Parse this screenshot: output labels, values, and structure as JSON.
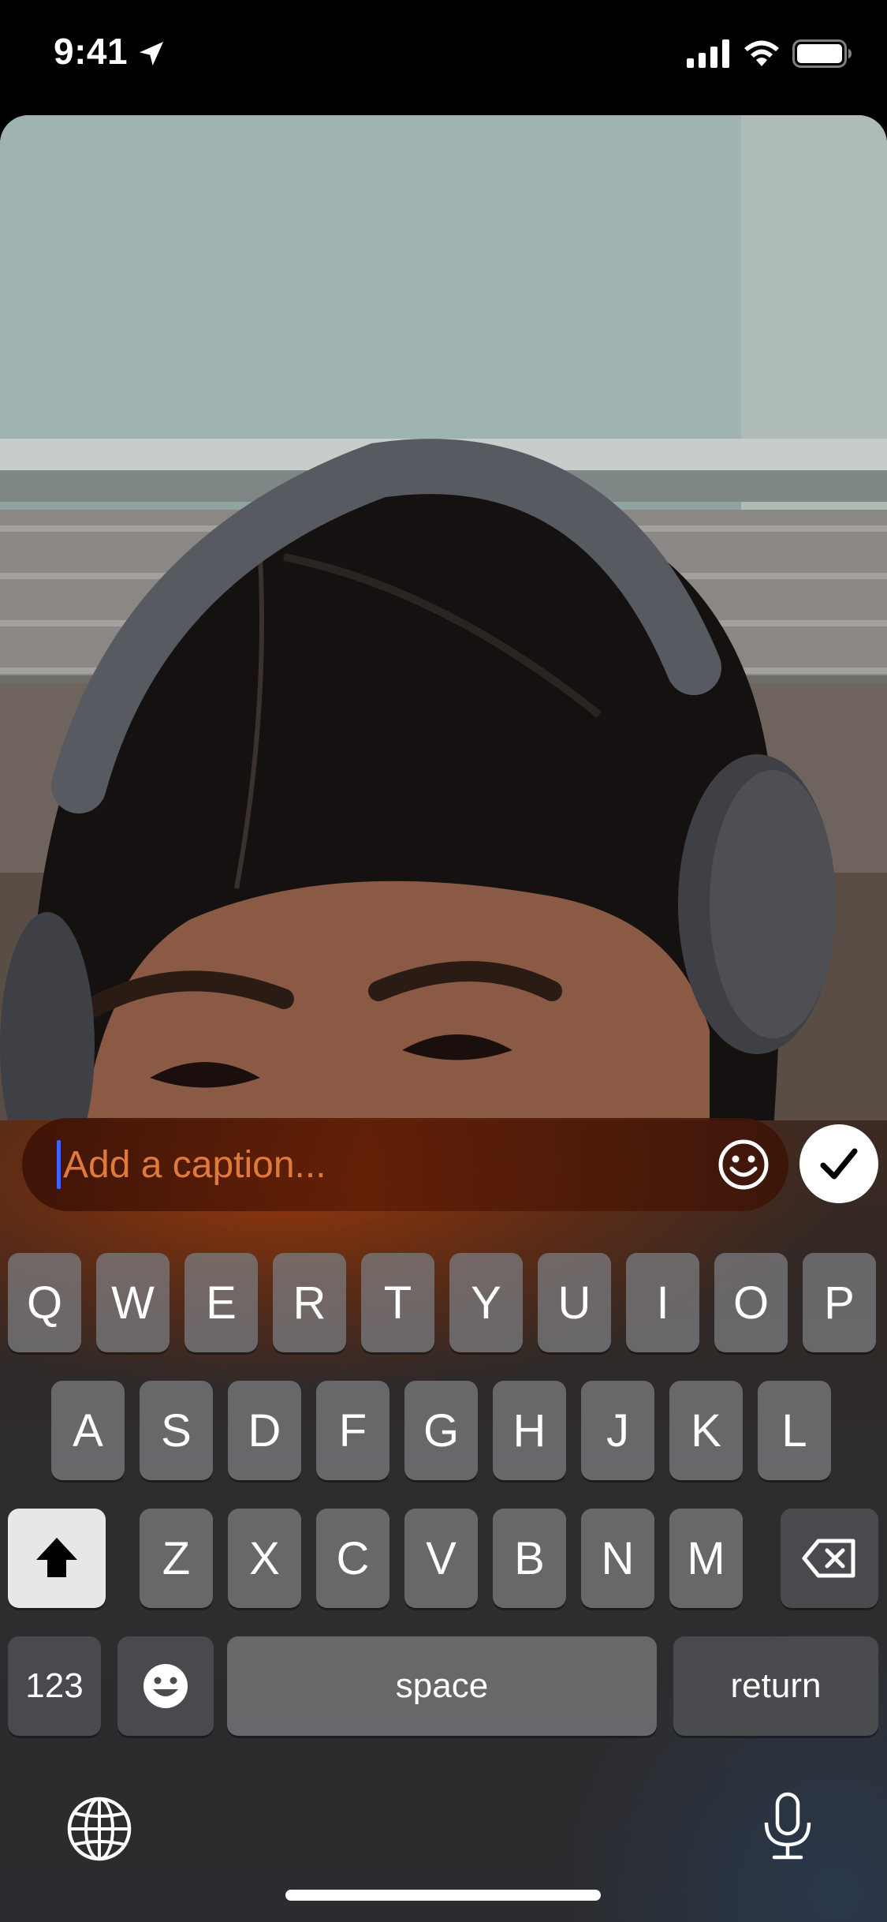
{
  "status_bar": {
    "time": "9:41",
    "icons": [
      "location-arrow-icon",
      "cellular-signal-icon",
      "wifi-icon",
      "battery-icon"
    ]
  },
  "photo": {
    "description_icon": "photo-preview"
  },
  "caption": {
    "placeholder": "Add a caption...",
    "emoji_icon": "smiley-icon",
    "send_icon": "checkmark-icon"
  },
  "keyboard": {
    "row1": [
      "Q",
      "W",
      "E",
      "R",
      "T",
      "Y",
      "U",
      "I",
      "O",
      "P"
    ],
    "row2": [
      "A",
      "S",
      "D",
      "F",
      "G",
      "H",
      "J",
      "K",
      "L"
    ],
    "row3": [
      "Z",
      "X",
      "C",
      "V",
      "B",
      "N",
      "M"
    ],
    "numbers_label": "123",
    "space_label": "space",
    "return_label": "return",
    "shift_icon": "shift-arrow-icon",
    "delete_icon": "backspace-icon",
    "emoji_icon": "emoji-face-icon",
    "globe_icon": "globe-icon",
    "mic_icon": "microphone-icon"
  },
  "colors": {
    "placeholder": "#e07a3b",
    "caret": "#3f63ff",
    "caption_bg": "#5f1e06"
  }
}
